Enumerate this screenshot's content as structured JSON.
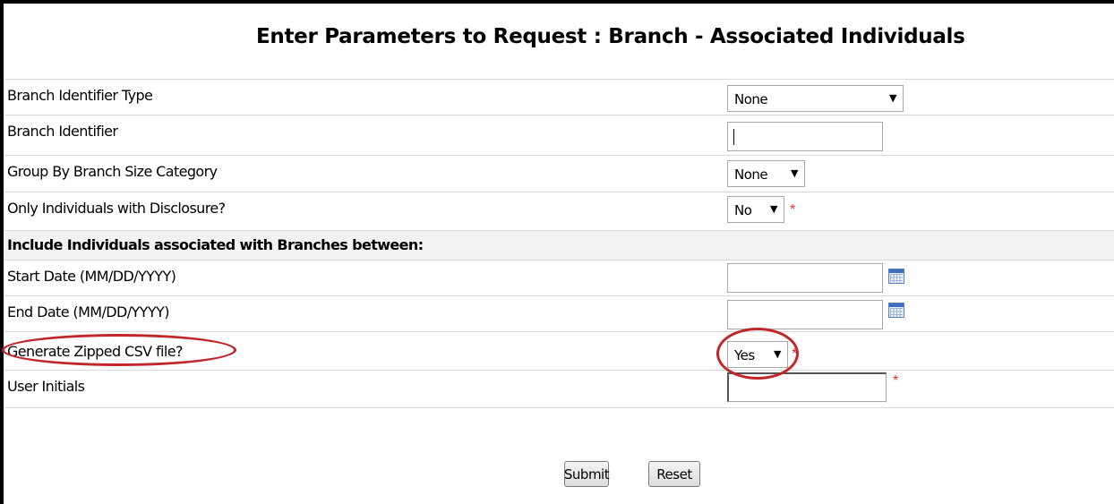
{
  "page": {
    "title": "Enter Parameters to Request : Branch - Associated Individuals"
  },
  "form": {
    "branch_identifier_type": {
      "label": "Branch Identifier Type",
      "value": "None"
    },
    "branch_identifier": {
      "label": "Branch Identifier",
      "value": ""
    },
    "group_by_branch_size": {
      "label": "Group By Branch Size Category",
      "value": "None"
    },
    "only_with_disclosure": {
      "label": "Only Individuals with Disclosure?",
      "value": "No"
    },
    "section_heading": "Include Individuals associated with Branches between:",
    "start_date": {
      "label": "Start Date (MM/DD/YYYY)",
      "value": ""
    },
    "end_date": {
      "label": "End Date (MM/DD/YYYY)",
      "value": ""
    },
    "generate_zipped_csv": {
      "label": "Generate Zipped CSV file?",
      "value": "Yes"
    },
    "user_initials": {
      "label": "User Initials",
      "value": ""
    },
    "required_marker": "*"
  },
  "buttons": {
    "submit": "Submit",
    "reset": "Reset"
  },
  "icons": {
    "calendar": "calendar-icon",
    "dropdown": "chevron-down-icon"
  },
  "colors": {
    "required": "#e03030",
    "highlight_oval": "#c0262a",
    "section_bg": "#f2f2f2"
  }
}
